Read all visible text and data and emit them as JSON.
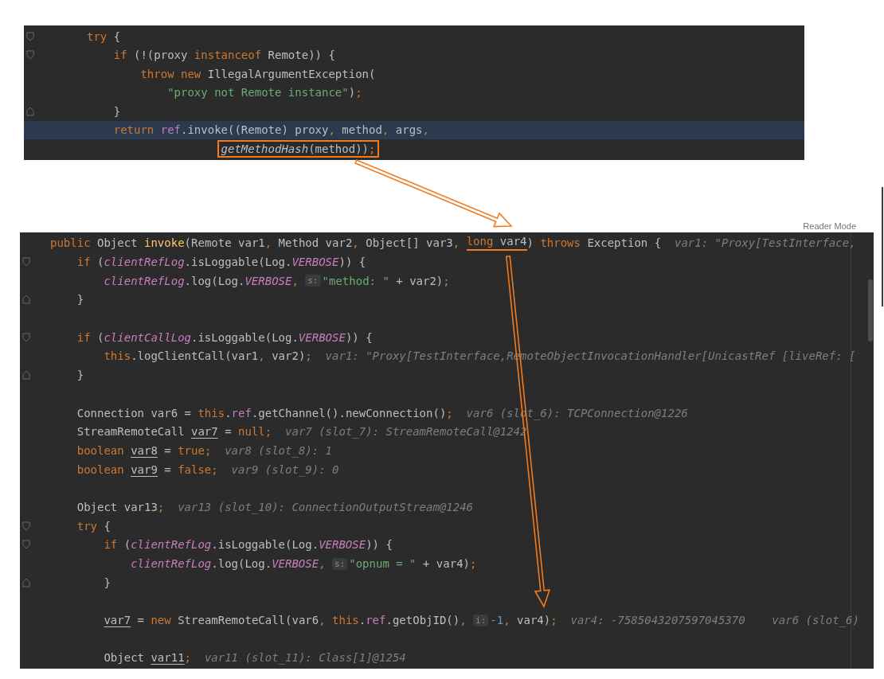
{
  "top_editor": {
    "lines": [
      {
        "kind": "opener",
        "tokens": [
          {
            "t": "try",
            "kind": "kw"
          },
          {
            "t": " {",
            "kind": "plain"
          }
        ],
        "children": [
          {
            "kind": "opener",
            "tokens": [
              {
                "t": "if",
                "kind": "kw"
              },
              {
                "t": " (!(proxy ",
                "kind": "plain"
              },
              {
                "t": "instanceof",
                "kind": "kw"
              },
              {
                "t": " Remote)) {",
                "kind": "plain"
              }
            ],
            "children": [
              {
                "kind": "plain",
                "tokens": [
                  {
                    "t": "throw ",
                    "kind": "kw"
                  },
                  {
                    "t": "new",
                    "kind": "kw"
                  },
                  {
                    "t": " IllegalArgumentException(",
                    "kind": "plain"
                  }
                ],
                "children": [
                  {
                    "kind": "plain",
                    "tokens": [
                      {
                        "t": "\"proxy not Remote instance\"",
                        "kind": "str"
                      },
                      {
                        "t": ")",
                        "kind": "plain"
                      },
                      {
                        "t": ";",
                        "kind": "punct"
                      }
                    ]
                  }
                ]
              }
            ]
          },
          {
            "kind": "closer",
            "tokens": [
              {
                "t": "}",
                "kind": "plain"
              }
            ]
          },
          {
            "kind": "plain",
            "highlighted": true,
            "tokens": [
              {
                "t": "return ",
                "kind": "kw"
              },
              {
                "t": "ref",
                "kind": "member"
              },
              {
                "t": ".invoke((Remote) proxy",
                "kind": "plain"
              },
              {
                "t": ",",
                "kind": "punct"
              },
              {
                "t": " method",
                "kind": "plain"
              },
              {
                "t": ",",
                "kind": "punct"
              },
              {
                "t": " args",
                "kind": "plain"
              },
              {
                "t": ",",
                "kind": "punct"
              }
            ],
            "children": [
              {
                "kind": "continuation",
                "tokens": [
                  {
                    "t": "getMethodHash",
                    "kind": "static",
                    "boxed": true
                  },
                  {
                    "t": "(method))",
                    "kind": "plain",
                    "boxed": true
                  },
                  {
                    "t": ";",
                    "kind": "punct",
                    "boxed": true
                  }
                ]
              }
            ]
          }
        ]
      }
    ]
  },
  "bottom_editor": {
    "reader_mode_label": "Reader Mode",
    "lines": [
      {
        "kind": "plain",
        "tokens": [
          {
            "t": "public",
            "kind": "kw"
          },
          {
            "t": " Object ",
            "kind": "plain"
          },
          {
            "t": "invoke",
            "kind": "fn"
          },
          {
            "t": "(Remote var1",
            "kind": "plain"
          },
          {
            "t": ",",
            "kind": "punct"
          },
          {
            "t": " Method var2",
            "kind": "plain"
          },
          {
            "t": ",",
            "kind": "punct"
          },
          {
            "t": " Object[] var3",
            "kind": "plain"
          },
          {
            "t": ", ",
            "kind": "punct"
          },
          {
            "t": "long",
            "kind": "kw",
            "underlined": true
          },
          {
            "t": " var4",
            "kind": "plain",
            "underlined": true
          },
          {
            "t": ") ",
            "kind": "plain"
          },
          {
            "t": "throws",
            "kind": "kw"
          },
          {
            "t": " Exception {  ",
            "kind": "plain"
          },
          {
            "t": "var1: \"Proxy[TestInterface,",
            "kind": "hint"
          }
        ],
        "children": [
          {
            "kind": "opener",
            "tokens": [
              {
                "t": "if",
                "kind": "kw"
              },
              {
                "t": " (",
                "kind": "plain"
              },
              {
                "t": "clientRefLog",
                "kind": "field"
              },
              {
                "t": ".isLoggable(Log.",
                "kind": "plain"
              },
              {
                "t": "VERBOSE",
                "kind": "field"
              },
              {
                "t": ")) {",
                "kind": "plain"
              }
            ],
            "children": [
              {
                "kind": "plain",
                "tokens": [
                  {
                    "t": "clientRefLog",
                    "kind": "field"
                  },
                  {
                    "t": ".log(Log.",
                    "kind": "plain"
                  },
                  {
                    "t": "VERBOSE",
                    "kind": "field"
                  },
                  {
                    "t": ", ",
                    "kind": "punct"
                  },
                  {
                    "t": "s:",
                    "kind": "badge"
                  },
                  {
                    "t": "\"method: \"",
                    "kind": "str"
                  },
                  {
                    "t": " + var2)",
                    "kind": "plain"
                  },
                  {
                    "t": ";",
                    "kind": "punct"
                  }
                ]
              }
            ]
          },
          {
            "kind": "closer",
            "tokens": [
              {
                "t": "}",
                "kind": "plain"
              }
            ]
          },
          {
            "kind": "blank"
          },
          {
            "kind": "opener",
            "tokens": [
              {
                "t": "if",
                "kind": "kw"
              },
              {
                "t": " (",
                "kind": "plain"
              },
              {
                "t": "clientCallLog",
                "kind": "field"
              },
              {
                "t": ".isLoggable(Log.",
                "kind": "plain"
              },
              {
                "t": "VERBOSE",
                "kind": "field"
              },
              {
                "t": ")) {",
                "kind": "plain"
              }
            ],
            "children": [
              {
                "kind": "plain",
                "tokens": [
                  {
                    "t": "this",
                    "kind": "kw"
                  },
                  {
                    "t": ".logClientCall(var1",
                    "kind": "plain"
                  },
                  {
                    "t": ",",
                    "kind": "punct"
                  },
                  {
                    "t": " var2)",
                    "kind": "plain"
                  },
                  {
                    "t": ";  ",
                    "kind": "punct"
                  },
                  {
                    "t": "var1: \"Proxy[TestInterface,RemoteObjectInvocationHandler[UnicastRef [liveRef: [",
                    "kind": "hint"
                  }
                ]
              }
            ]
          },
          {
            "kind": "closer",
            "tokens": [
              {
                "t": "}",
                "kind": "plain"
              }
            ]
          },
          {
            "kind": "blank"
          },
          {
            "kind": "plain",
            "tokens": [
              {
                "t": "Connection var6 = ",
                "kind": "plain"
              },
              {
                "t": "this",
                "kind": "kw"
              },
              {
                "t": ".",
                "kind": "plain"
              },
              {
                "t": "ref",
                "kind": "member"
              },
              {
                "t": ".getChannel().newConnection()",
                "kind": "plain"
              },
              {
                "t": ";  ",
                "kind": "punct"
              },
              {
                "t": "var6 (slot_6): TCPConnection@1226",
                "kind": "hint"
              }
            ]
          },
          {
            "kind": "plain",
            "tokens": [
              {
                "t": "StreamRemoteCall ",
                "kind": "plain"
              },
              {
                "t": "var7",
                "kind": "reassigned"
              },
              {
                "t": " = ",
                "kind": "plain"
              },
              {
                "t": "null",
                "kind": "kw"
              },
              {
                "t": ";  ",
                "kind": "punct"
              },
              {
                "t": "var7 (slot_7): StreamRemoteCall@1242",
                "kind": "hint"
              }
            ]
          },
          {
            "kind": "plain",
            "tokens": [
              {
                "t": "boolean ",
                "kind": "kw"
              },
              {
                "t": "var8",
                "kind": "reassigned"
              },
              {
                "t": " = ",
                "kind": "plain"
              },
              {
                "t": "true",
                "kind": "kw"
              },
              {
                "t": ";  ",
                "kind": "punct"
              },
              {
                "t": "var8 (slot_8): 1",
                "kind": "hint"
              }
            ]
          },
          {
            "kind": "plain",
            "tokens": [
              {
                "t": "boolean ",
                "kind": "kw"
              },
              {
                "t": "var9",
                "kind": "reassigned"
              },
              {
                "t": " = ",
                "kind": "plain"
              },
              {
                "t": "false",
                "kind": "kw"
              },
              {
                "t": ";  ",
                "kind": "punct"
              },
              {
                "t": "var9 (slot_9): 0",
                "kind": "hint"
              }
            ]
          },
          {
            "kind": "blank"
          },
          {
            "kind": "plain",
            "tokens": [
              {
                "t": "Object var13",
                "kind": "plain"
              },
              {
                "t": ";  ",
                "kind": "punct"
              },
              {
                "t": "var13 (slot_10): ConnectionOutputStream@1246",
                "kind": "hint"
              }
            ]
          },
          {
            "kind": "opener",
            "tokens": [
              {
                "t": "try",
                "kind": "kw"
              },
              {
                "t": " {",
                "kind": "plain"
              }
            ],
            "children": [
              {
                "kind": "opener",
                "tokens": [
                  {
                    "t": "if",
                    "kind": "kw"
                  },
                  {
                    "t": " (",
                    "kind": "plain"
                  },
                  {
                    "t": "clientRefLog",
                    "kind": "field"
                  },
                  {
                    "t": ".isLoggable(Log.",
                    "kind": "plain"
                  },
                  {
                    "t": "VERBOSE",
                    "kind": "field"
                  },
                  {
                    "t": ")) {",
                    "kind": "plain"
                  }
                ],
                "children": [
                  {
                    "kind": "plain",
                    "tokens": [
                      {
                        "t": "clientRefLog",
                        "kind": "field"
                      },
                      {
                        "t": ".log(Log.",
                        "kind": "plain"
                      },
                      {
                        "t": "VERBOSE",
                        "kind": "field"
                      },
                      {
                        "t": ", ",
                        "kind": "punct"
                      },
                      {
                        "t": "s:",
                        "kind": "badge"
                      },
                      {
                        "t": "\"opnum = \"",
                        "kind": "str"
                      },
                      {
                        "t": " + var4)",
                        "kind": "plain"
                      },
                      {
                        "t": ";",
                        "kind": "punct"
                      }
                    ]
                  }
                ]
              },
              {
                "kind": "closer",
                "tokens": [
                  {
                    "t": "}",
                    "kind": "plain"
                  }
                ]
              },
              {
                "kind": "blank"
              },
              {
                "kind": "plain",
                "tokens": [
                  {
                    "t": "var7",
                    "kind": "reassigned"
                  },
                  {
                    "t": " = ",
                    "kind": "plain"
                  },
                  {
                    "t": "new",
                    "kind": "kw"
                  },
                  {
                    "t": " StreamRemoteCall(var6",
                    "kind": "plain"
                  },
                  {
                    "t": ", ",
                    "kind": "punct"
                  },
                  {
                    "t": "this",
                    "kind": "kw"
                  },
                  {
                    "t": ".",
                    "kind": "plain"
                  },
                  {
                    "t": "ref",
                    "kind": "member"
                  },
                  {
                    "t": ".getObjID()",
                    "kind": "plain"
                  },
                  {
                    "t": ", ",
                    "kind": "punct"
                  },
                  {
                    "t": "i:",
                    "kind": "badge"
                  },
                  {
                    "t": "-1",
                    "kind": "num"
                  },
                  {
                    "t": ",",
                    "kind": "punct"
                  },
                  {
                    "t": " var4)",
                    "kind": "plain"
                  },
                  {
                    "t": ";  ",
                    "kind": "punct"
                  },
                  {
                    "t": "var4: -7585043207597045370    ",
                    "kind": "hint"
                  },
                  {
                    "t": "var6 (slot_6)",
                    "kind": "hint"
                  }
                ]
              },
              {
                "kind": "blank"
              },
              {
                "kind": "plain",
                "tokens": [
                  {
                    "t": "Object ",
                    "kind": "plain"
                  },
                  {
                    "t": "var11",
                    "kind": "reassigned"
                  },
                  {
                    "t": ";  ",
                    "kind": "punct"
                  },
                  {
                    "t": "var11 (slot_11): Class[1]@1254",
                    "kind": "hint"
                  }
                ]
              }
            ]
          }
        ]
      }
    ]
  }
}
